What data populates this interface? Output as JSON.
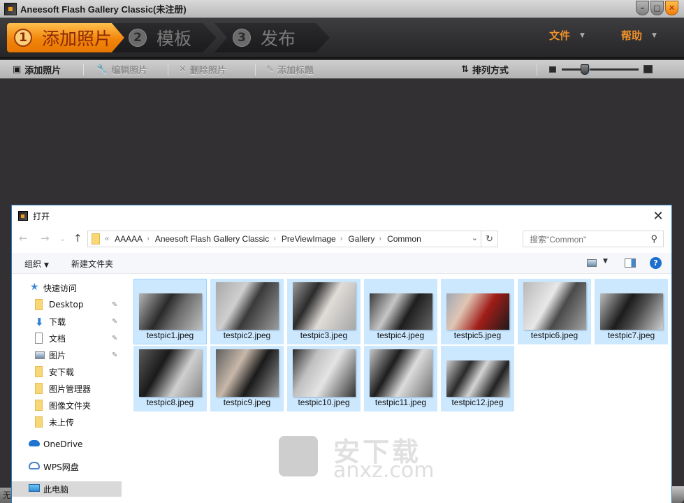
{
  "window": {
    "title": "Aneesoft Flash Gallery Classic(未注册)",
    "controls": {
      "minimize": "–",
      "maximize": "□",
      "close": "✕"
    }
  },
  "wizard": {
    "steps": [
      {
        "num": "1",
        "label": "添加照片",
        "active": true
      },
      {
        "num": "2",
        "label": "模板",
        "active": false
      },
      {
        "num": "3",
        "label": "发布",
        "active": false
      }
    ],
    "menus": [
      {
        "label": "文件",
        "caret": "▼"
      },
      {
        "label": "帮助",
        "caret": "▼"
      }
    ],
    "accent_color": "#f0922a"
  },
  "toolbar": {
    "add_photo": {
      "label": "添加照片",
      "icon": "▣"
    },
    "edit_photo": {
      "label": "编辑照片",
      "icon": "🔧"
    },
    "delete_photo": {
      "label": "删除照片",
      "icon": "✕"
    },
    "add_title": {
      "label": "添加标题",
      "icon": "✎"
    },
    "sort": {
      "label": "排列方式",
      "icon": "⇅"
    },
    "zoom_slider_value": 0.3
  },
  "dialog": {
    "title": "打开",
    "close_glyph": "✕",
    "nav": {
      "back": "←",
      "forward": "→",
      "recent": "⌄",
      "up": "↑"
    },
    "address": {
      "overflow": "«",
      "crumbs": [
        "AAAAA",
        "Aneesoft Flash Gallery Classic",
        "PreViewImage",
        "Gallery",
        "Common"
      ],
      "separator": "›",
      "dropdown": "⌄",
      "refresh": "↻"
    },
    "search": {
      "placeholder": "搜索\"Common\"",
      "icon": "⚲"
    },
    "commands": {
      "organize": "组织",
      "organize_caret": "▼",
      "new_folder": "新建文件夹",
      "view_caret": "▼",
      "help": "?"
    },
    "sidebar": {
      "quick_access": "快速访问",
      "items": [
        {
          "label": "Desktop",
          "icon": "folder",
          "pinned": true
        },
        {
          "label": "下载",
          "icon": "download",
          "pinned": true
        },
        {
          "label": "文档",
          "icon": "document",
          "pinned": true
        },
        {
          "label": "图片",
          "icon": "pictures",
          "pinned": true
        },
        {
          "label": "安下载",
          "icon": "folder",
          "pinned": false
        },
        {
          "label": "图片管理器",
          "icon": "folder",
          "pinned": false
        },
        {
          "label": "图像文件夹",
          "icon": "folder",
          "pinned": false
        },
        {
          "label": "未上传",
          "icon": "folder",
          "pinned": false
        }
      ],
      "onedrive": "OneDrive",
      "wps": "WPS网盘",
      "this_pc": "此电脑",
      "pin_glyph": "📌"
    },
    "files": [
      {
        "name": "testpic1.jpeg"
      },
      {
        "name": "testpic2.jpeg"
      },
      {
        "name": "testpic3.jpeg"
      },
      {
        "name": "testpic4.jpeg"
      },
      {
        "name": "testpic5.jpeg"
      },
      {
        "name": "testpic6.jpeg"
      },
      {
        "name": "testpic7.jpeg"
      },
      {
        "name": "testpic8.jpeg"
      },
      {
        "name": "testpic9.jpeg"
      },
      {
        "name": "testpic10.jpeg"
      },
      {
        "name": "testpic11.jpeg"
      },
      {
        "name": "testpic12.jpeg"
      }
    ],
    "selection_color": "#cce8ff"
  },
  "watermark": {
    "line1": "安下载",
    "line2": "anxz.com"
  },
  "status": {
    "left_char": "无"
  }
}
